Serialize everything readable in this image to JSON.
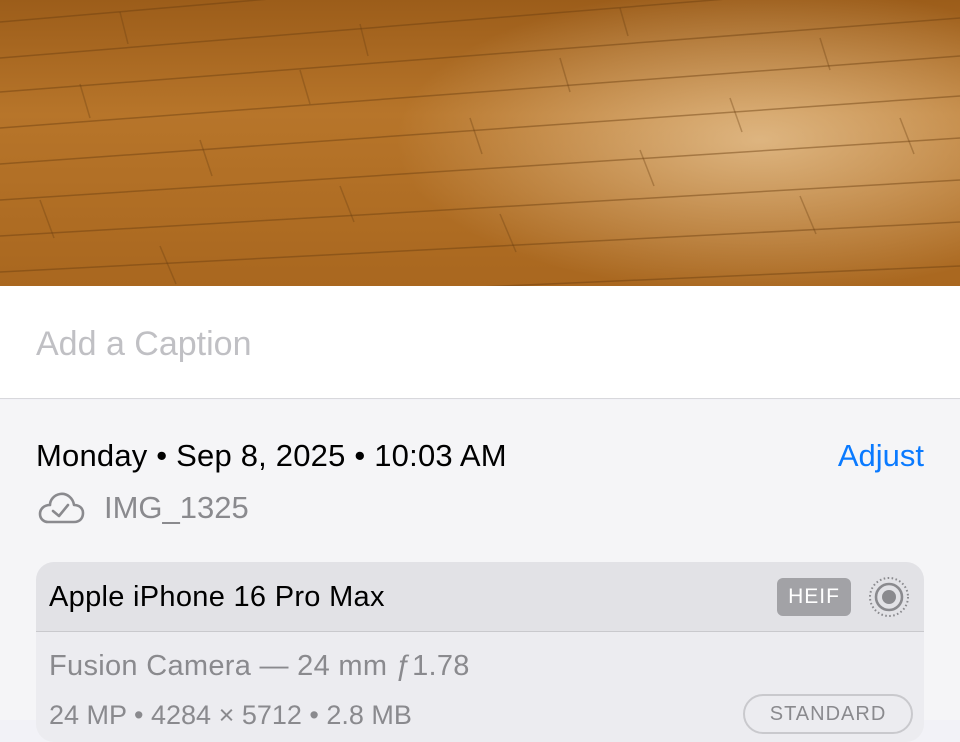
{
  "photo": {
    "description_icon": "hardwood-floor-photo"
  },
  "caption": {
    "placeholder": "Add a Caption"
  },
  "info": {
    "date_time": "Monday • Sep 8, 2025 • 10:03 AM",
    "adjust_label": "Adjust",
    "file_icon": "icloud-check-icon",
    "file_name": "IMG_1325"
  },
  "camera_card": {
    "device": "Apple iPhone 16 Pro Max",
    "format_badge": "HEIF",
    "live_photo_icon": "live-photo-icon",
    "lens": "Fusion Camera — 24 mm ƒ1.78",
    "specs": "24 MP • 4284 × 5712 • 2.8 MB",
    "style_badge": "STANDARD"
  },
  "colors": {
    "accent": "#0a7aff",
    "secondary_text": "#8a8a8e",
    "placeholder": "#c0c0c4"
  }
}
